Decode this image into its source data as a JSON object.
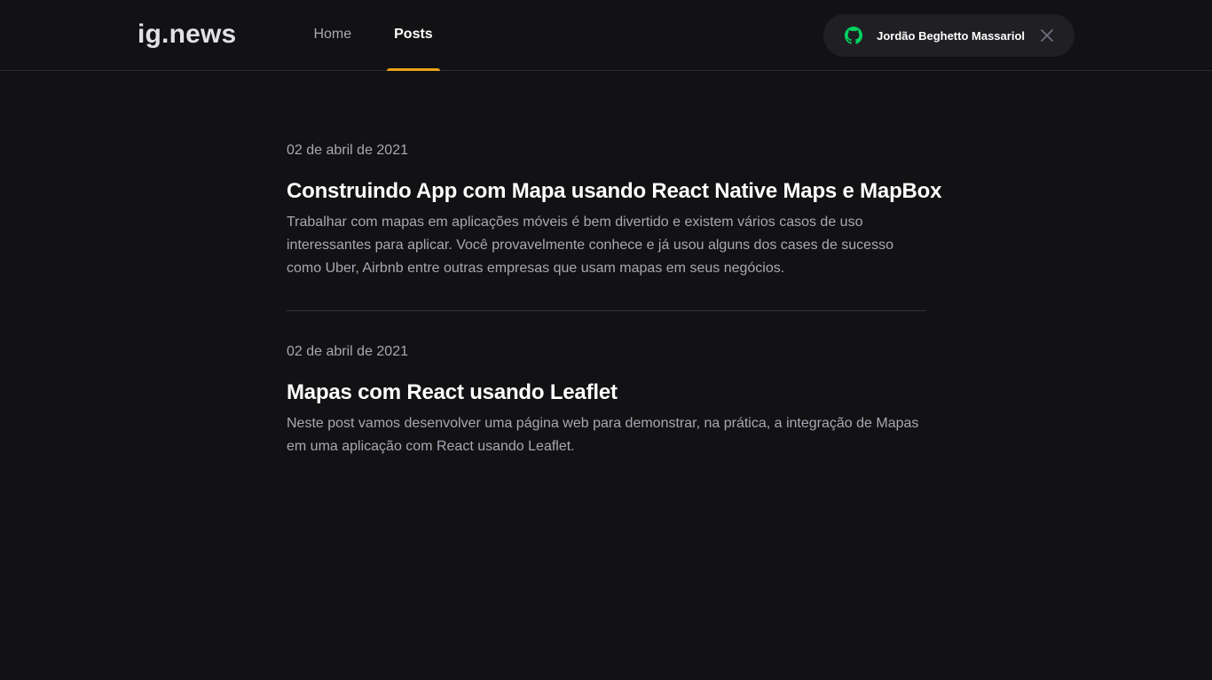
{
  "header": {
    "logo": "ig.news",
    "nav": [
      {
        "label": "Home",
        "active": false
      },
      {
        "label": "Posts",
        "active": true
      }
    ],
    "user": {
      "name": "Jordão Beghetto Massariol",
      "icon": "github-icon",
      "close_icon": "close-icon"
    }
  },
  "posts": [
    {
      "date": "02 de abril de 2021",
      "title": "Construindo App com Mapa usando React Native Maps e MapBox",
      "excerpt": "Trabalhar com mapas em aplicações móveis é bem divertido e existem vários casos de uso interessantes para aplicar. Você provavelmente conhece e já usou alguns dos cases de sucesso como Uber, Airbnb entre outras empresas que usam mapas em seus negócios."
    },
    {
      "date": "02 de abril de 2021",
      "title": "Mapas com React usando Leaflet",
      "excerpt": "Neste post vamos desenvolver uma página web para demonstrar, na prática, a integração de Mapas em uma aplicação com React usando Leaflet."
    }
  ],
  "colors": {
    "background": "#121214",
    "accent": "#eba417",
    "github_green": "#04d361"
  }
}
